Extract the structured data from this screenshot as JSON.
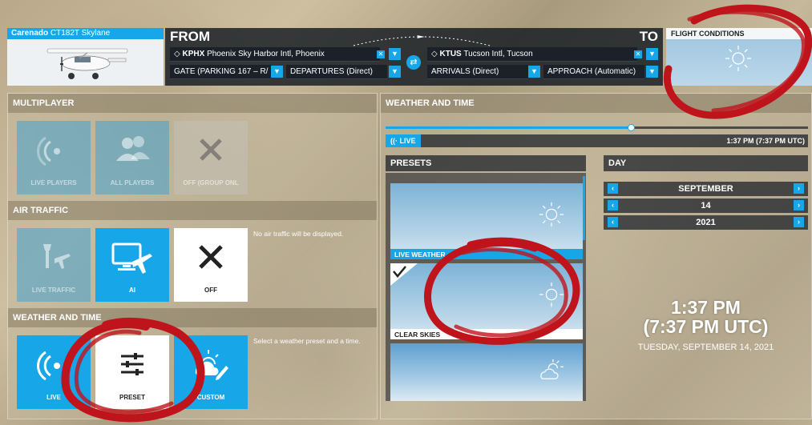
{
  "aircraft": {
    "brand": "Carenado",
    "model": "CT182T Skylane"
  },
  "route": {
    "from_label": "FROM",
    "to_label": "TO",
    "from_airport_code": "KPHX",
    "from_airport_name": "Phoenix Sky Harbor Intl, Phoenix",
    "to_airport_code": "KTUS",
    "to_airport_name": "Tucson Intl, Tucson",
    "from_gate": "GATE (PARKING 167 – R/",
    "from_departure": "DEPARTURES (Direct)",
    "to_arrival": "ARRIVALS (Direct)",
    "to_approach": "APPROACH (Automatic)"
  },
  "flight_conditions": {
    "title": "FLIGHT CONDITIONS",
    "icon": "sun-icon"
  },
  "multiplayer": {
    "title": "MULTIPLAYER",
    "options": [
      {
        "label": "LIVE PLAYERS",
        "icon": "broadcast-icon"
      },
      {
        "label": "ALL PLAYERS",
        "icon": "users-icon"
      },
      {
        "label": "OFF (GROUP ONL",
        "icon": "close-icon"
      }
    ]
  },
  "air_traffic": {
    "title": "AIR TRAFFIC",
    "options": [
      {
        "label": "LIVE TRAFFIC",
        "icon": "tower-plane-icon"
      },
      {
        "label": "AI",
        "icon": "monitor-plane-icon"
      },
      {
        "label": "OFF",
        "icon": "close-icon"
      }
    ],
    "description": "No air traffic will be displayed."
  },
  "weather_left": {
    "title": "WEATHER AND TIME",
    "options": [
      {
        "label": "LIVE",
        "icon": "broadcast-icon"
      },
      {
        "label": "PRESET",
        "icon": "sliders-icon"
      },
      {
        "label": "CUSTOM",
        "icon": "sun-cloud-edit-icon"
      }
    ],
    "description": "Select a weather preset and a time."
  },
  "weather_right": {
    "title": "WEATHER AND TIME",
    "live_label": "LIVE",
    "time_readout": "1:37 PM (7:37 PM UTC)",
    "slider_value": 0.58
  },
  "presets": {
    "title": "PRESETS",
    "items": [
      {
        "label": "LIVE WEATHER",
        "icon": "sun-icon",
        "selected": false
      },
      {
        "label": "CLEAR SKIES",
        "icon": "sun-icon",
        "selected": true
      },
      {
        "label": "",
        "icon": "sun-cloud-icon",
        "selected": false
      }
    ]
  },
  "day": {
    "title": "DAY",
    "month": "SEPTEMBER",
    "date": "14",
    "year": "2021"
  },
  "clock": {
    "local_time": "1:37 PM",
    "utc_time": "(7:37 PM UTC)",
    "full_date": "TUESDAY, SEPTEMBER 14, 2021"
  },
  "colors": {
    "accent": "#17a7e8",
    "annotation": "#c0141c"
  }
}
